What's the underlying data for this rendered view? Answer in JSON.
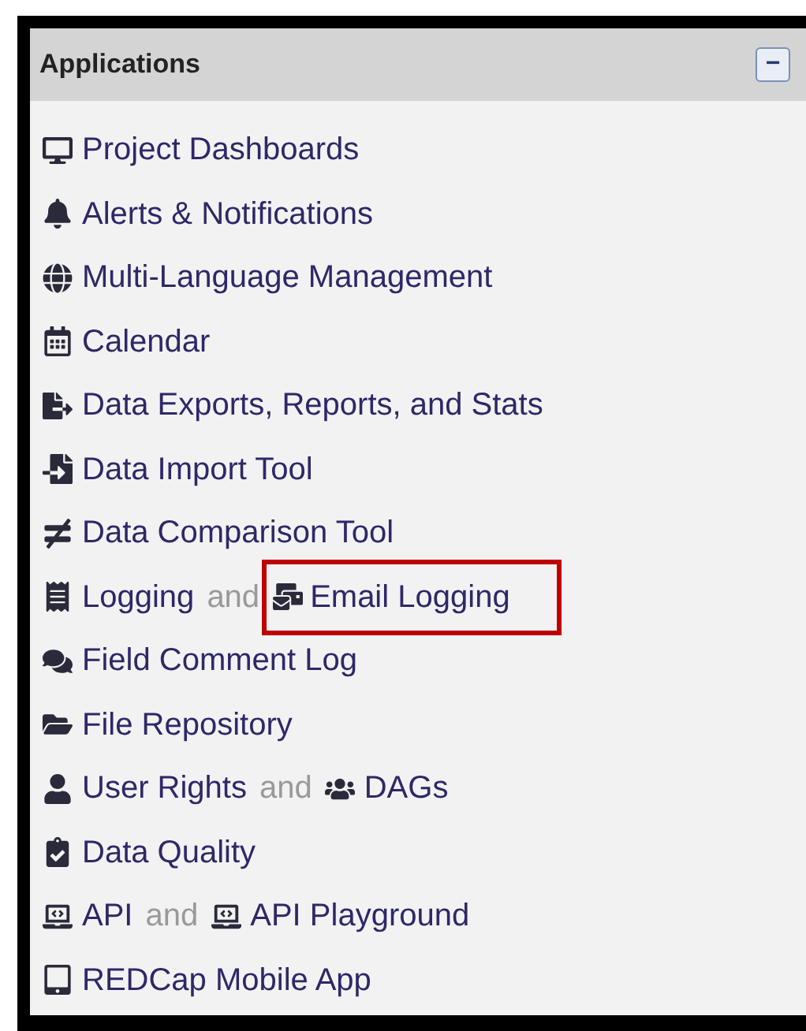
{
  "panel": {
    "title": "Applications",
    "collapse_button": {
      "label": "−"
    }
  },
  "rows": [
    {
      "links": [
        {
          "label": "Project Dashboards",
          "highlighted": false
        }
      ]
    },
    {
      "links": [
        {
          "label": "Alerts & Notifications",
          "highlighted": false
        }
      ]
    },
    {
      "links": [
        {
          "label": "Multi-Language Management",
          "highlighted": false
        }
      ]
    },
    {
      "links": [
        {
          "label": "Calendar",
          "highlighted": false
        }
      ]
    },
    {
      "links": [
        {
          "label": "Data Exports, Reports, and Stats",
          "highlighted": false
        }
      ]
    },
    {
      "links": [
        {
          "label": "Data Import Tool",
          "highlighted": false
        }
      ]
    },
    {
      "links": [
        {
          "label": "Data Comparison Tool",
          "highlighted": false
        }
      ]
    },
    {
      "links": [
        {
          "label": "Logging",
          "highlighted": false
        },
        {
          "label": "Email Logging",
          "highlighted": true
        }
      ],
      "joiner": "and"
    },
    {
      "links": [
        {
          "label": "Field Comment Log",
          "highlighted": false
        }
      ]
    },
    {
      "links": [
        {
          "label": "File Repository",
          "highlighted": false
        }
      ]
    },
    {
      "links": [
        {
          "label": "User Rights",
          "highlighted": false
        },
        {
          "label": "DAGs",
          "highlighted": false
        }
      ],
      "joiner": "and"
    },
    {
      "links": [
        {
          "label": "Data Quality",
          "highlighted": false
        }
      ]
    },
    {
      "links": [
        {
          "label": "API",
          "highlighted": false
        },
        {
          "label": "API Playground",
          "highlighted": false
        }
      ],
      "joiner": "and"
    },
    {
      "links": [
        {
          "label": "REDCap Mobile App",
          "highlighted": false
        }
      ]
    }
  ]
}
